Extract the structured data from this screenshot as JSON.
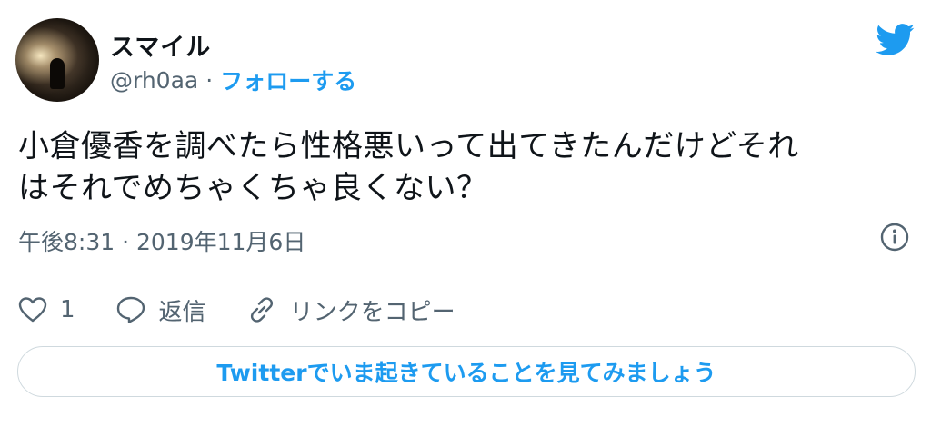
{
  "user": {
    "display_name": "スマイル",
    "handle": "@rh0aa",
    "separator": "·",
    "follow_label": "フォローする"
  },
  "tweet": {
    "text_line1": "小倉優香を調べたら性格悪いって出てきたんだけどそれ",
    "text_line2": "はそれでめちゃくちゃ良くない？",
    "timestamp": "午後8:31 · 2019年11月6日"
  },
  "actions": {
    "like_count": "1",
    "reply_label": "返信",
    "copy_link_label": "リンクをコピー"
  },
  "explore_button_label": "Twitterでいま起きていることを見てみましょう",
  "icons": [
    "twitter-bird-icon",
    "info-icon",
    "heart-icon",
    "reply-icon",
    "link-icon"
  ],
  "colors": {
    "accent": "#1d9bf0",
    "secondary_text": "#536471",
    "border": "#cfd9de"
  }
}
